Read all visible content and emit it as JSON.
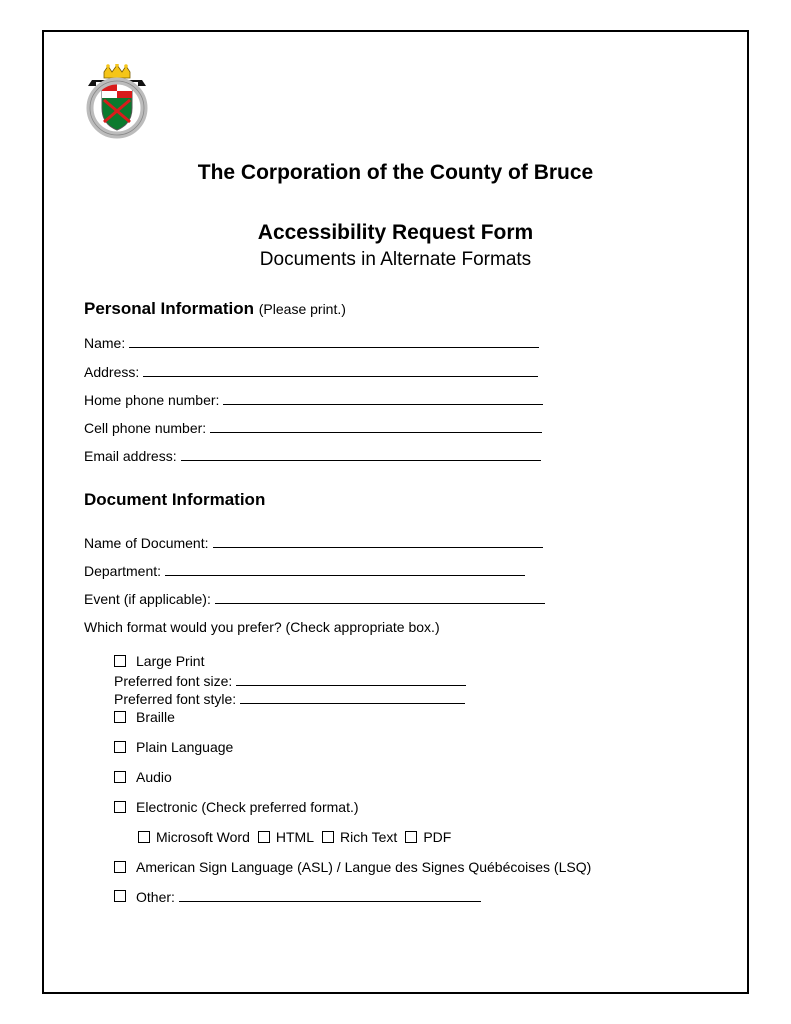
{
  "header": {
    "org_title": "The Corporation of the County of Bruce",
    "form_title": "Accessibility Request Form",
    "subtitle": "Documents in Alternate Formats"
  },
  "personal": {
    "heading": "Personal Information",
    "hint": "(Please print.)",
    "fields": {
      "name": "Name:",
      "address": "Address:",
      "home_phone": "Home phone number:",
      "cell_phone": "Cell phone number:",
      "email": "Email address:"
    }
  },
  "document": {
    "heading": "Document Information",
    "fields": {
      "doc_name": "Name of Document:",
      "department": "Department:",
      "event": "Event (if applicable):"
    },
    "format_question": "Which format would you prefer? (Check appropriate box.)",
    "options": {
      "large_print": "Large Print",
      "preferred_size": "Preferred font size:",
      "preferred_style": "Preferred font style:",
      "braille": "Braille",
      "plain": "Plain Language",
      "audio": "Audio",
      "electronic": "Electronic (Check preferred format.)",
      "elec_word": "Microsoft Word",
      "elec_html": "HTML",
      "elec_rich": "Rich Text",
      "elec_pdf": "PDF",
      "asl": "American Sign Language (ASL) / Langue des Signes Québécoises (LSQ)",
      "other": "Other:"
    }
  }
}
